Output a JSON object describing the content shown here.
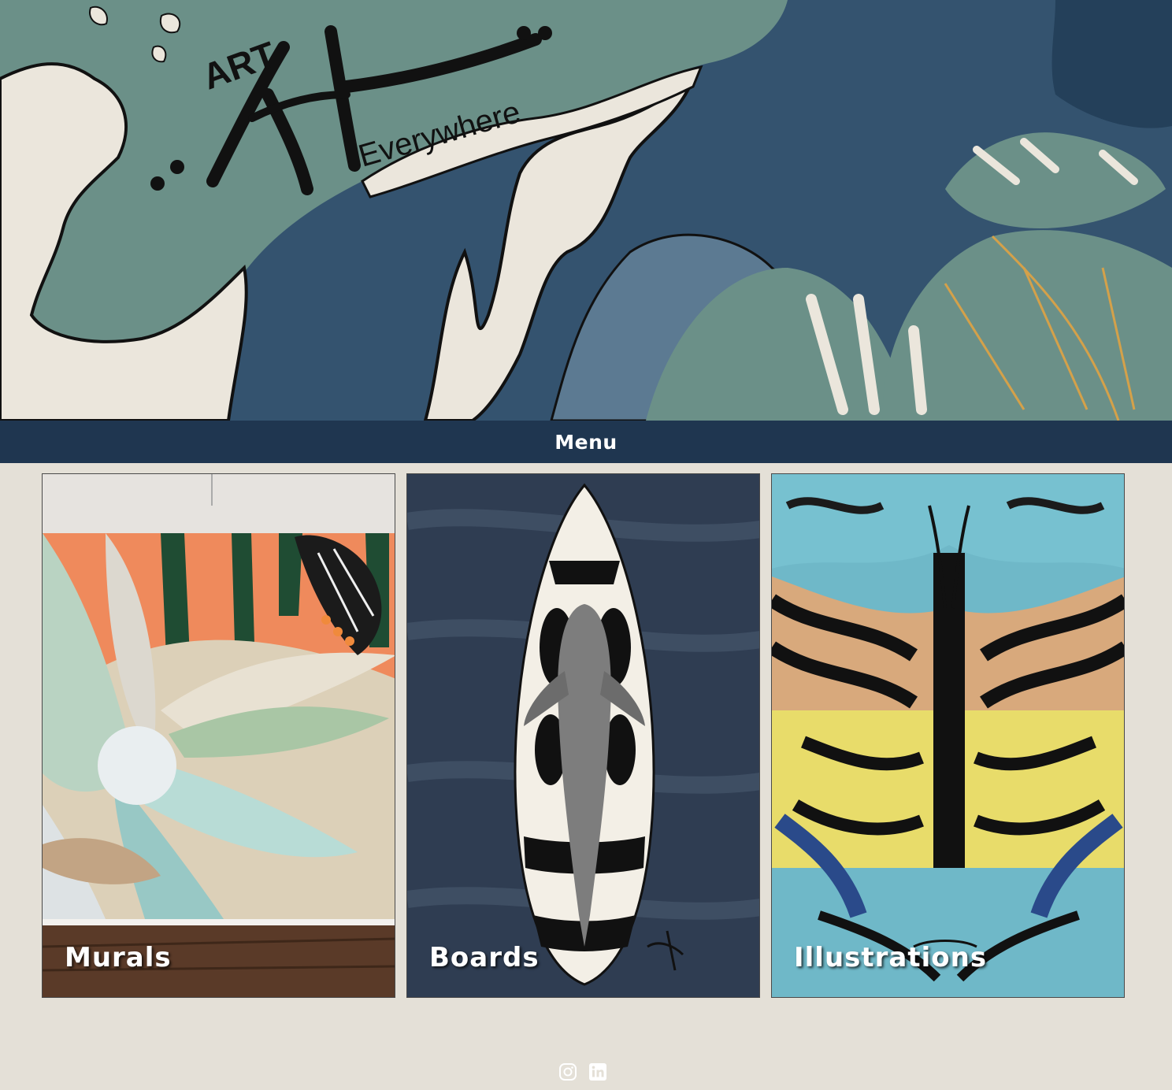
{
  "hero": {
    "logo_art": "ART",
    "logo_tagline": "Everywhere"
  },
  "menu": {
    "label": "Menu"
  },
  "gallery": {
    "cards": [
      {
        "title": "Murals"
      },
      {
        "title": "Boards"
      },
      {
        "title": "Illustrations"
      }
    ]
  },
  "footer": {
    "icons": [
      "instagram-icon",
      "linkedin-icon"
    ]
  },
  "colors": {
    "page_bg": "#e4e0d7",
    "menu_bg": "#1f3650",
    "hero_sea": "#34536f",
    "hero_land": "#6b9088",
    "hero_shore": "#ebe6dc"
  }
}
